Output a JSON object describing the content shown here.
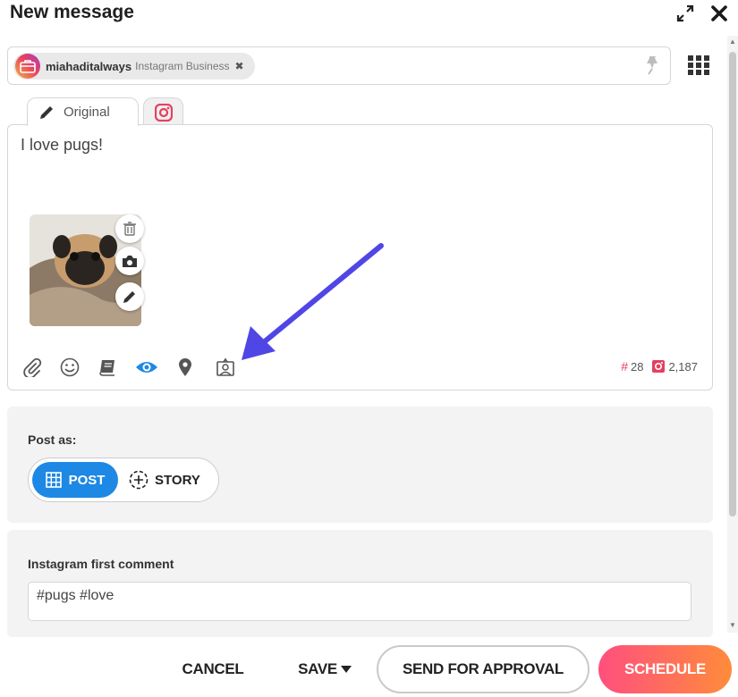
{
  "window": {
    "title": "New message"
  },
  "profile": {
    "name": "miahaditalways",
    "type": "Instagram Business"
  },
  "tabs": {
    "original_label": "Original"
  },
  "composer": {
    "text": "I love pugs!"
  },
  "counts": {
    "hashtags": "28",
    "characters": "2,187"
  },
  "post_as": {
    "label": "Post as:",
    "post_label": "POST",
    "story_label": "STORY"
  },
  "first_comment": {
    "label": "Instagram first comment",
    "value": "#pugs #love"
  },
  "footer": {
    "cancel": "CANCEL",
    "save": "SAVE",
    "approval": "SEND FOR APPROVAL",
    "schedule": "SCHEDULE"
  },
  "icons": {
    "expand": "expand-icon",
    "close": "close-icon",
    "pin": "pin-icon",
    "grid": "grid-icon",
    "attach": "paperclip-icon",
    "emoji": "emoji-icon",
    "library": "book-icon",
    "preview": "eye-icon",
    "location": "location-pin-icon",
    "tag": "tag-user-icon",
    "delete": "trash-icon",
    "camera": "camera-icon",
    "edit": "pencil-icon"
  },
  "colors": {
    "accent": "#1e88e5",
    "instagram": "#e4405f",
    "arrow": "#5046e5",
    "schedule_start": "#ff4f7e",
    "schedule_end": "#ff8c3a"
  }
}
